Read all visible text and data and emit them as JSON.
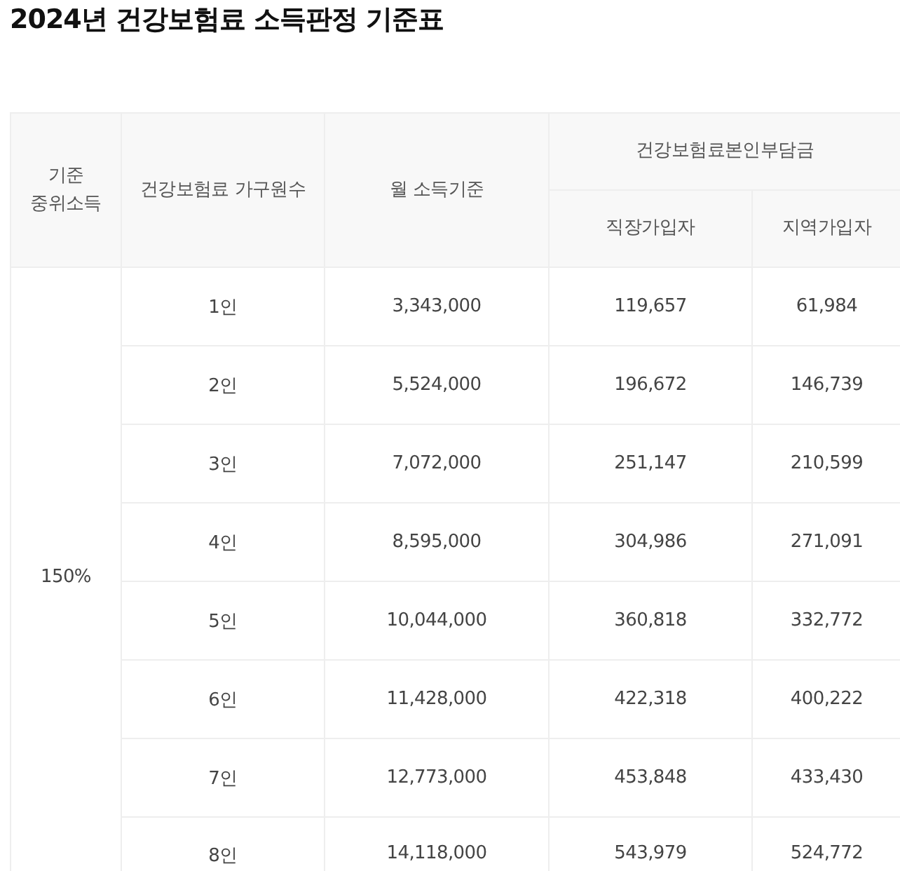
{
  "title": "2024년 건강보험료 소득판정 기준표",
  "table": {
    "columns": [
      "기준\n중위소득",
      "건강보험료 가구원수",
      "월 소득기준"
    ],
    "column_group": {
      "label": "건강보험료본인부담금",
      "columns": [
        "직장가입자",
        "지역가입자"
      ]
    },
    "median_income": "150%",
    "rows": [
      {
        "household": "1인",
        "monthly_income": "3,343,000",
        "employee": "119,657",
        "regional": "61,984"
      },
      {
        "household": "2인",
        "monthly_income": "5,524,000",
        "employee": "196,672",
        "regional": "146,739"
      },
      {
        "household": "3인",
        "monthly_income": "7,072,000",
        "employee": "251,147",
        "regional": "210,599"
      },
      {
        "household": "4인",
        "monthly_income": "8,595,000",
        "employee": "304,986",
        "regional": "271,091"
      },
      {
        "household": "5인",
        "monthly_income": "10,044,000",
        "employee": "360,818",
        "regional": "332,772"
      },
      {
        "household": "6인",
        "monthly_income": "11,428,000",
        "employee": "422,318",
        "regional": "400,222"
      },
      {
        "household": "7인",
        "monthly_income": "12,773,000",
        "employee": "453,848",
        "regional": "433,430"
      },
      {
        "household": "8인",
        "monthly_income": "14,118,000",
        "employee": "543,979",
        "regional": "524,772"
      }
    ]
  }
}
